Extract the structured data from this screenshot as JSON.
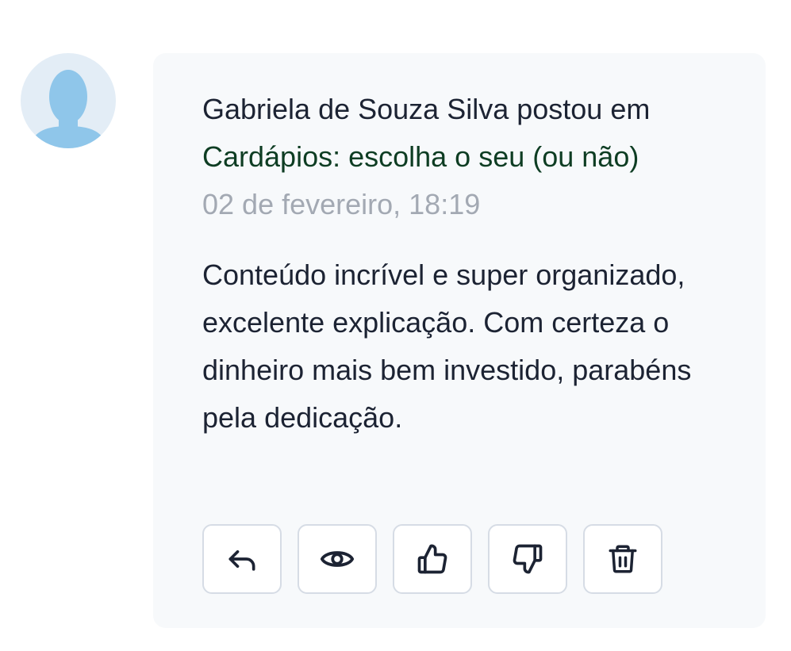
{
  "post": {
    "author_line": "Gabriela de Souza Silva postou em",
    "topic": "Cardápios: escolha o seu (ou não)",
    "timestamp": "02 de fevereiro, 18:19",
    "body": "Conteúdo incrível e super organizado, excelente explicação. Com certeza o dinheiro mais bem investido, parabéns pela dedicação."
  },
  "actions": [
    {
      "icon": "reply-icon"
    },
    {
      "icon": "eye-icon"
    },
    {
      "icon": "thumbs-up-icon"
    },
    {
      "icon": "thumbs-down-icon"
    },
    {
      "icon": "trash-icon"
    }
  ],
  "colors": {
    "card_background": "#f7f9fb",
    "text": "#1c2333",
    "link": "#0e3d23",
    "muted": "#a3a9b3",
    "avatar": "#8fc6ea"
  }
}
